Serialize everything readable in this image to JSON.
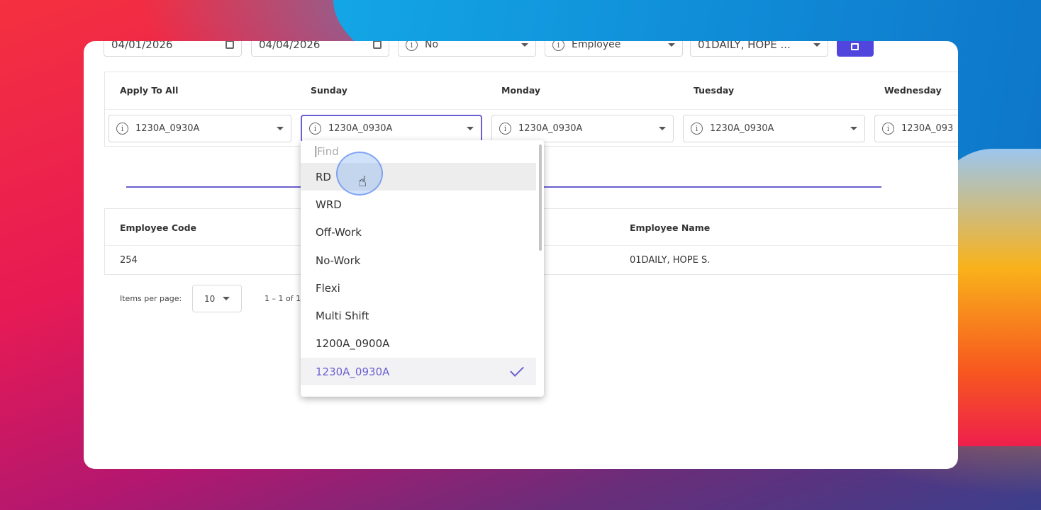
{
  "filters": {
    "date_from": "04/01/2026",
    "date_to": "04/04/2026",
    "option": "No",
    "type": "Employee",
    "employee": "01DAILY, HOPE ..."
  },
  "schedule": {
    "headers": [
      "Apply To All",
      "Sunday",
      "Monday",
      "Tuesday",
      "Wednesday"
    ],
    "values": [
      "1230A_0930A",
      "1230A_0930A",
      "1230A_0930A",
      "1230A_0930A",
      "1230A_093"
    ]
  },
  "dropdown": {
    "placeholder": "Find",
    "options": [
      "RD",
      "WRD",
      "Off-Work",
      "No-Work",
      "Flexi",
      "Multi Shift",
      "1200A_0900A",
      "1230A_0930A"
    ],
    "selected": "1230A_0930A",
    "hovered": "RD"
  },
  "table": {
    "headers": [
      "Employee Code",
      "Employee Name"
    ],
    "rows": [
      [
        "254",
        "01DAILY, HOPE S."
      ]
    ]
  },
  "pagination": {
    "label": "Items per page:",
    "size": "10",
    "range": "1 – 1 of 1"
  },
  "colors": {
    "accent": "#5b4fd6",
    "selected_text": "#6a5fd0"
  }
}
